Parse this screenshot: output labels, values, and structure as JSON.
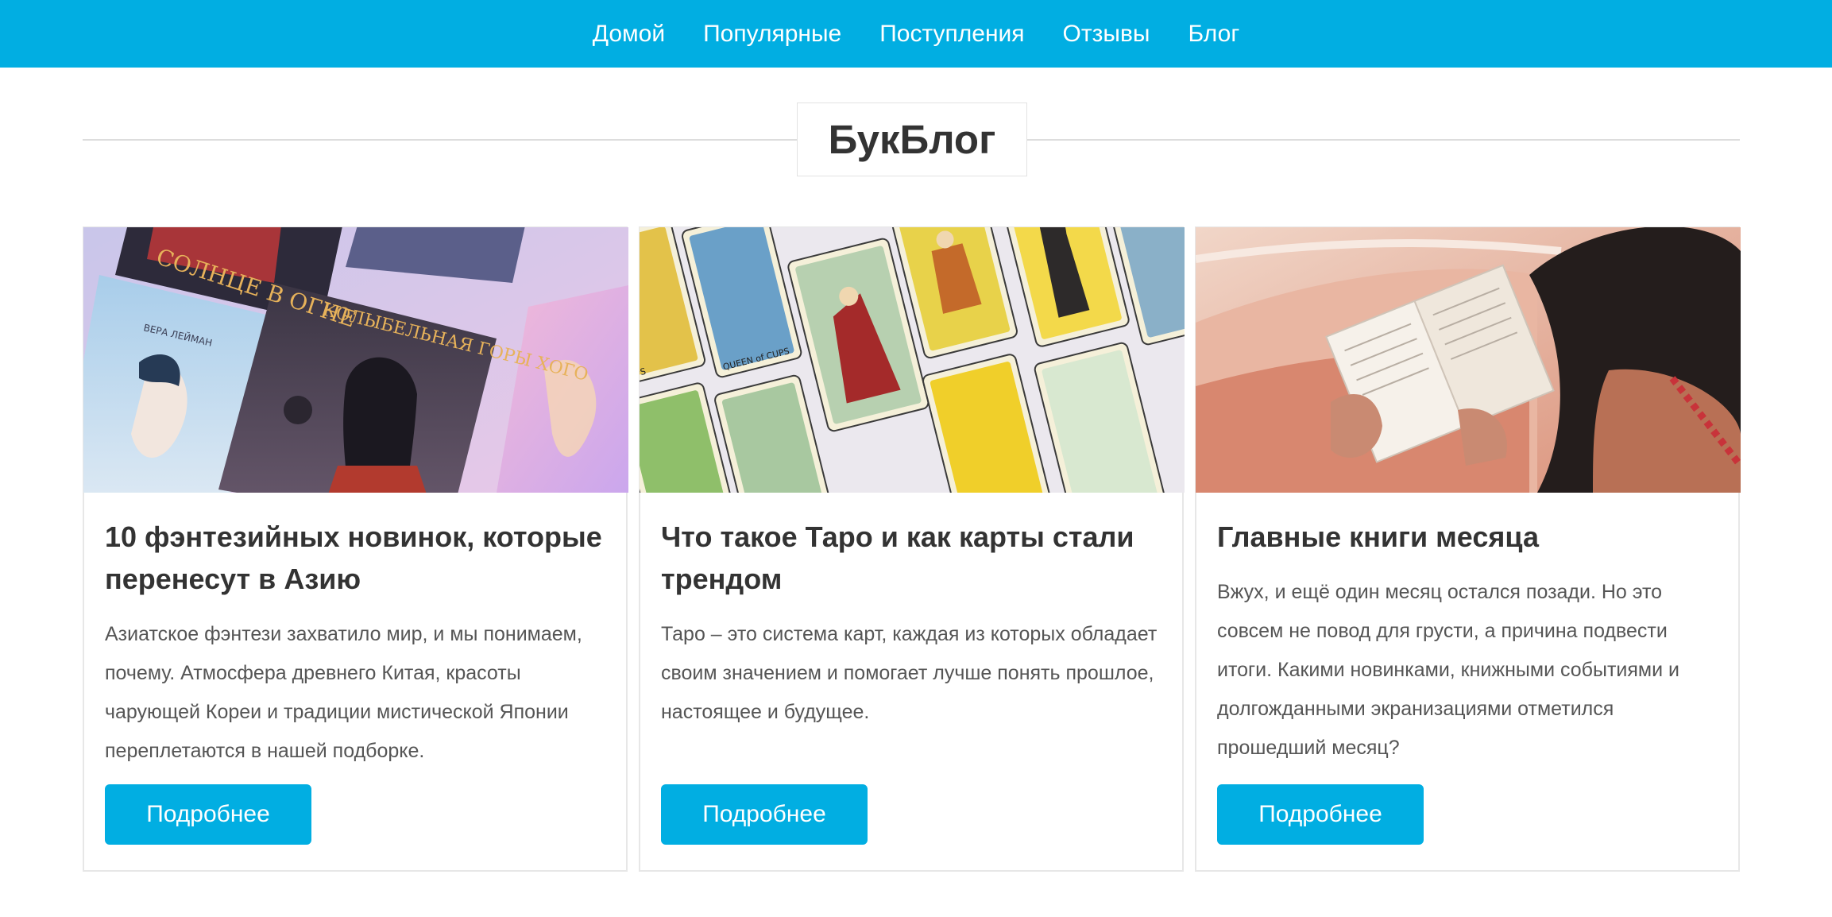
{
  "nav": {
    "items": [
      "Домой",
      "Популярные",
      "Поступления",
      "Отзывы",
      "Блог"
    ]
  },
  "page": {
    "title": "БукБлог"
  },
  "cards": [
    {
      "title": "10 фэнтезийных новинок, которые перенесут в Азию",
      "text": "Азиатское фэнтези захватило мир, и мы понимаем, почему. Атмосфера древнего Китая, красоты чарующей Кореи и традиции мистической Японии переплетаются в нашей подборке.",
      "button": "Подробнее",
      "image": "asian-fantasy-books-cover",
      "image_text": [
        "ВЕРА ЛЕЙМАН",
        "СОЛНЦЕ В ОГНЕ",
        "КОЛЫБЕЛЬНАЯ ГОРЫ ХОГО"
      ]
    },
    {
      "title": "Что такое Таро и как карты стали трендом",
      "text": "Таро – это система карт, каждая из которых обладает своим значением и помогает лучше понять прошлое, настоящее и будущее.",
      "button": "Подробнее",
      "image": "tarot-cards-photo",
      "image_text": [
        "QUEEN of CUPS",
        "CUPS"
      ]
    },
    {
      "title": "Главные книги месяца",
      "text": "Вжух, и ещё один месяц остался позади. Но это совсем не повод для грусти, а причина подвести итоги. Какими новинками, книжными событиями и долгожданными экранизациями отметился прошедший месяц?",
      "button": "Подробнее",
      "image": "woman-reading-on-boat-photo"
    }
  ],
  "colors": {
    "accent": "#01aee2",
    "text": "#333333",
    "muted": "#555555",
    "border": "#e7e7e7"
  }
}
